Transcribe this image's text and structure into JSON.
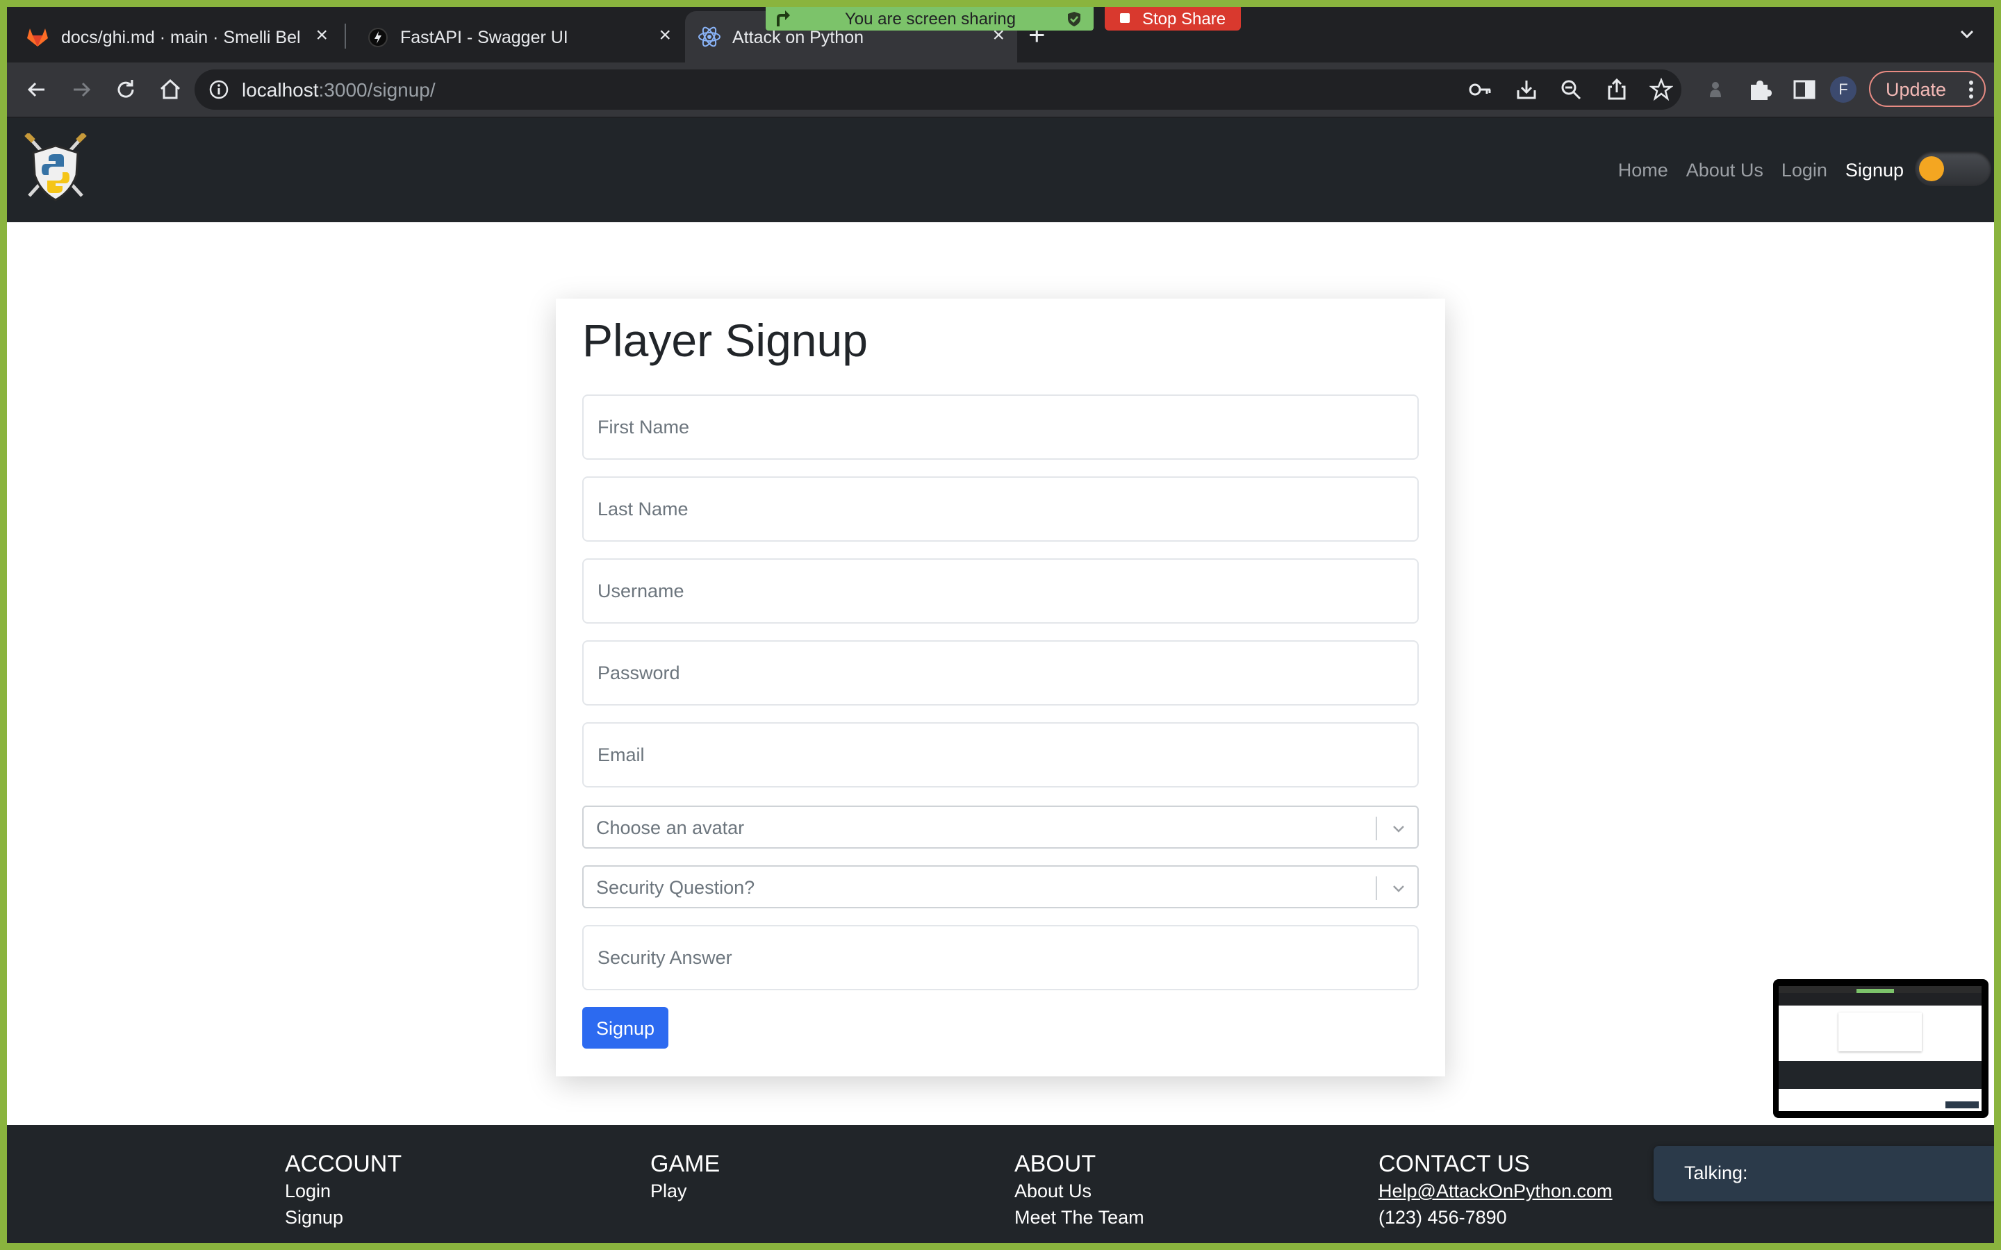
{
  "browser": {
    "tabs": [
      {
        "title": "docs/ghi.md · main · Smelli Bel",
        "icon": "gitlab-icon"
      },
      {
        "title": "FastAPI - Swagger UI",
        "icon": "fastapi-icon"
      },
      {
        "title": "Attack on Python",
        "icon": "react-icon"
      }
    ],
    "active_tab": 2,
    "url_host": "localhost",
    "url_path": ":3000/signup/",
    "update_label": "Update",
    "profile_initial": "F"
  },
  "share_banner": {
    "sharing_text": "You are screen sharing",
    "stop_label": "Stop Share"
  },
  "navbar": {
    "links": [
      "Home",
      "About Us",
      "Login",
      "Signup"
    ],
    "active": "Signup"
  },
  "form": {
    "title": "Player Signup",
    "first_name_ph": "First Name",
    "last_name_ph": "Last Name",
    "username_ph": "Username",
    "password_ph": "Password",
    "email_ph": "Email",
    "avatar_ph": "Choose an avatar",
    "security_q_ph": "Security Question?",
    "security_a_ph": "Security Answer",
    "submit_label": "Signup"
  },
  "footer": {
    "account": {
      "head": "ACCOUNT",
      "items": [
        "Login",
        "Signup"
      ]
    },
    "game": {
      "head": "GAME",
      "items": [
        "Play"
      ]
    },
    "about": {
      "head": "ABOUT",
      "items": [
        "About Us",
        "Meet The Team"
      ]
    },
    "contact": {
      "head": "CONTACT US",
      "email": "Help@AttackOnPython.com",
      "phone": "(123) 456-7890"
    }
  },
  "talking": {
    "label": "Talking:"
  },
  "colors": {
    "frame": "#8ab43e",
    "navbar": "#212529",
    "primary": "#2c6af0",
    "stop": "#d9392e",
    "share": "#7cc36a"
  }
}
